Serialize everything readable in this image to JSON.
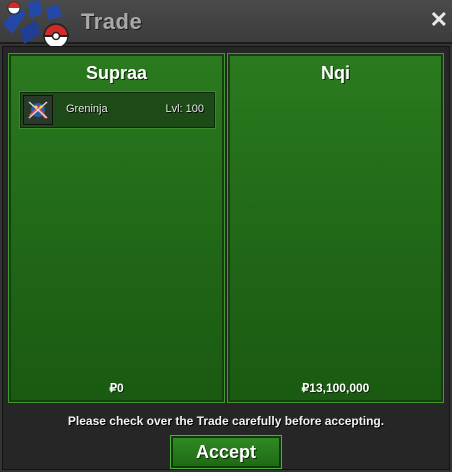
{
  "window": {
    "title": "Trade"
  },
  "left_panel": {
    "player_name": "Supraa",
    "pokemon": [
      {
        "name": "Greninja",
        "level": "Lvl: 100"
      }
    ],
    "money": "₽0"
  },
  "right_panel": {
    "player_name": "Nqi",
    "pokemon": [],
    "money": "₽13,100,000"
  },
  "footer": {
    "notice": "Please check over the Trade carefully before accepting.",
    "accept_label": "Accept"
  },
  "icons": {
    "logo": "pokeball-emblem-icon",
    "close": "close-icon",
    "pokemon_sprite": "greninja-sprite-icon"
  },
  "colors": {
    "panel_green": "#226a18",
    "panel_border": "#173d10",
    "window_bg": "#333333"
  }
}
